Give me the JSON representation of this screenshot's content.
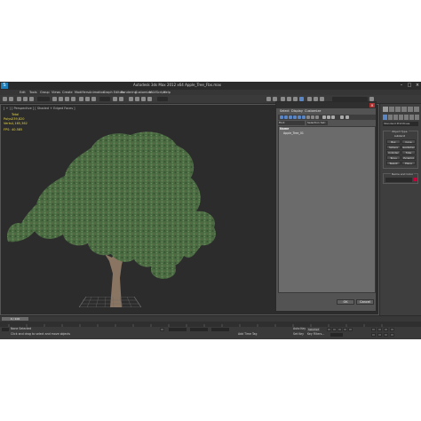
{
  "title_bar": {
    "logo_text": "S",
    "title": "Autodesk 3ds Max 2012 x64     Apple_Tree_Fbx.max"
  },
  "menu": [
    "Edit",
    "Tools",
    "Group",
    "Views",
    "Create",
    "Modifiers",
    "Animation",
    "Graph Editors",
    "Rendering",
    "Customize",
    "MAXScript",
    "Help"
  ],
  "viewport": {
    "label": "[ + ] [ Perspective ] [ Shaded + Edged Faces ]",
    "stats_header": "Total",
    "stats": [
      {
        "label": "Polys:",
        "value": "239,820"
      },
      {
        "label": "Verts:",
        "value": "1,165,362"
      }
    ],
    "fps_label": "FPS:",
    "fps_value": "40.585"
  },
  "scene_explorer": {
    "menu": [
      "Select",
      "Display",
      "Customize"
    ],
    "find_label": "Find:",
    "filter_label": "Selection Set:",
    "column_header": "Name",
    "rows": [
      "Apple_Tree_01"
    ],
    "ok_label": "OK",
    "cancel_label": "Cancel"
  },
  "command_panel": {
    "dropdown": "Standard Primitives",
    "object_type_title": "Object Type",
    "autogrid_label": "AutoGrid",
    "buttons": [
      "Box",
      "Cone",
      "Sphere",
      "GeoSphere",
      "Cylinder",
      "Tube",
      "Torus",
      "Pyramid",
      "Teapot",
      "Plane"
    ],
    "name_color_title": "Name and Color",
    "swatch_color": "#c8003c"
  },
  "timeline": {
    "slider": "0 / 100"
  },
  "status": {
    "selection": "None Selected",
    "prompt": "Click and drag to select and move objects",
    "autokey": "Auto Key",
    "selected": "Selected",
    "setkey": "Set Key",
    "keyfilters": "Key Filters...",
    "add_time_tag": "Add Time Tag"
  },
  "colors": {
    "viewport_bg": "#2c2c2c",
    "foliage": "#4a6a42",
    "trunk": "#8a7562",
    "stats_text": "#e6d54a"
  }
}
